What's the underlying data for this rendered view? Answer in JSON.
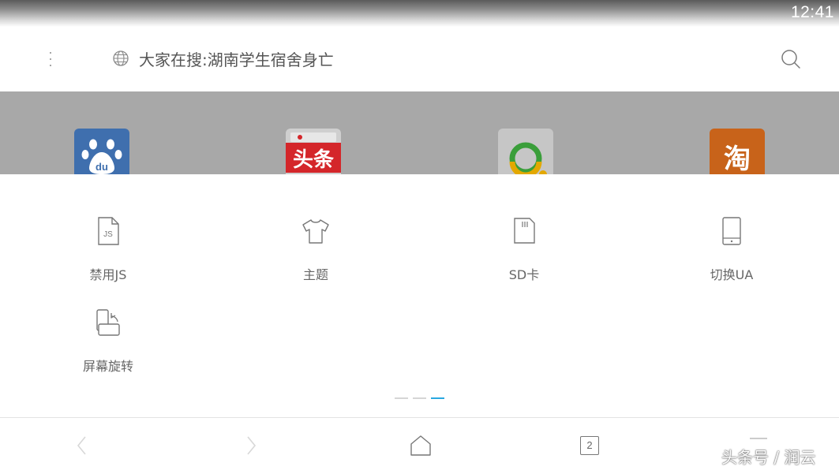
{
  "status_bar": {
    "time": "12:41"
  },
  "toolbar": {
    "search_hint": "大家在搜:湖南学生宿舍身亡"
  },
  "quick_tiles": [
    {
      "name": "baidu",
      "text": "du",
      "color": "#3f6fae"
    },
    {
      "name": "toutiao",
      "text": "头条",
      "color": "#d4262a"
    },
    {
      "name": "qq-browser",
      "text": "",
      "color": "#e3a800"
    },
    {
      "name": "taobao",
      "text": "淘",
      "color": "#c8631a"
    }
  ],
  "tools": [
    {
      "label": "禁用JS",
      "icon": "js-file-icon"
    },
    {
      "label": "主题",
      "icon": "tshirt-icon"
    },
    {
      "label": "SD卡",
      "icon": "sd-card-icon"
    },
    {
      "label": "切换UA",
      "icon": "phone-icon"
    },
    {
      "label": "屏幕旋转",
      "icon": "rotate-screen-icon"
    }
  ],
  "page_indicator": {
    "pages": 3,
    "active": 2,
    "active_color": "#29a8e0"
  },
  "navbar": {
    "tab_count": "2"
  },
  "watermark": "头条号 / 润云"
}
